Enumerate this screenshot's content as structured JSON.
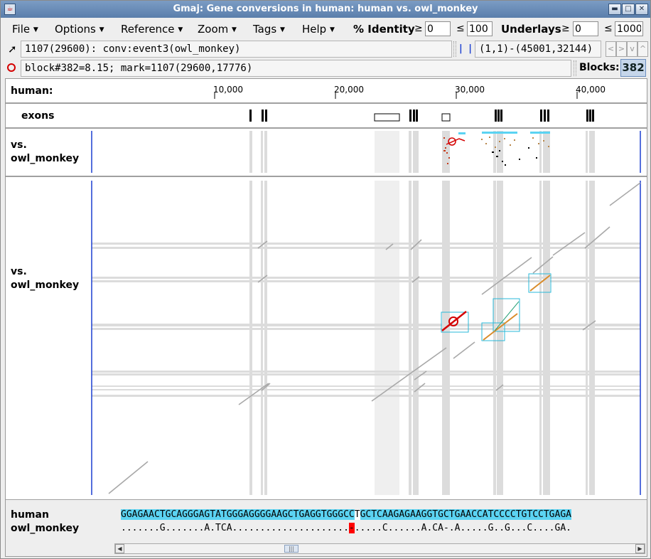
{
  "window": {
    "title": "Gmaj: Gene conversions in human: human vs. owl_monkey",
    "controls": {
      "minimize": "▬",
      "maximize": "□",
      "close": "✕"
    }
  },
  "menubar": {
    "file": "File",
    "options": "Options",
    "reference": "Reference",
    "zoom": "Zoom",
    "tags": "Tags",
    "help": "Help",
    "percent_identity_label": "% Identity",
    "pid_min": "0",
    "pid_max": "100",
    "underlays_label": "Underlays",
    "underlays_min": "0",
    "underlays_max": "1000",
    "ge_symbol": "≥",
    "le_symbol": "≤"
  },
  "info": {
    "position_readout": "1107(29600): conv:event3(owl_monkey)",
    "block_readout": "block#382=8.15; mark=1107(29600,17776)",
    "range_readout": "(1,1)-(45001,32144)",
    "blocks_label": "Blocks:",
    "blocks_count": "382",
    "marker_glyph": "| |"
  },
  "nav": {
    "back": "<",
    "forward": ">",
    "down": "v",
    "up": "^"
  },
  "ruler": {
    "label": "human:",
    "ticks": [
      {
        "value": 10000,
        "label": "10,000"
      },
      {
        "value": 20000,
        "label": "20,000"
      },
      {
        "value": 30000,
        "label": "30,000"
      },
      {
        "value": 40000,
        "label": "40,000"
      }
    ]
  },
  "exons_label": "exons",
  "pip_label": "vs.\nowl_monkey",
  "dotplot_label": "vs.\nowl_monkey",
  "alignment": {
    "ref_name": "human",
    "ref_seq": "GGAGAACTGCAGGGAGTATGGGAGGGGAAGCTGAGGTGGGCCTGCTCAAGAGAAGGTGCTGAACCATCCCCTGTCCTGAGA",
    "other_name": "owl_monkey",
    "other_seq": ".......G.......A.TCA.....................-.....C......A.CA-.A.....G..G...C....GA."
  },
  "colors": {
    "title_bar": "#5f83b1",
    "highlight": "#5bd3f2",
    "mismatch_mark": "#ff0000",
    "conversion_box": "#29b9d9",
    "conversion_line": "#d98c2b",
    "selected_conversion": "#d40000",
    "underlay": "#dcdcdc",
    "exon": "#000000",
    "axis": "#1b3fd1"
  }
}
